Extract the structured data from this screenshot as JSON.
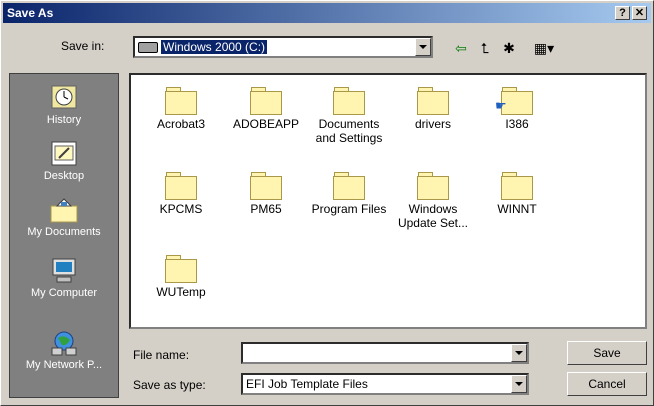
{
  "window": {
    "title": "Save As",
    "help_label": "?",
    "close_label": "✕"
  },
  "save_in": {
    "label": "Save in:",
    "value": "Windows 2000 (C:)"
  },
  "toolbar": {
    "back": "⇦",
    "up": "⮤",
    "new_folder": "✱",
    "views": "▦▾"
  },
  "places": [
    {
      "label": "History",
      "icon": "history-icon"
    },
    {
      "label": "Desktop",
      "icon": "desktop-icon"
    },
    {
      "label": "My Documents",
      "icon": "my-documents-icon"
    },
    {
      "label": "My Computer",
      "icon": "my-computer-icon"
    },
    {
      "label": "My Network P...",
      "icon": "my-network-places-icon"
    }
  ],
  "files": [
    {
      "name": "Acrobat3"
    },
    {
      "name": "ADOBEAPP"
    },
    {
      "name": "Documents and Settings"
    },
    {
      "name": "drivers"
    },
    {
      "name": "I386"
    },
    {
      "name": "KPCMS"
    },
    {
      "name": "PM65"
    },
    {
      "name": "Program Files"
    },
    {
      "name": "Windows Update Set..."
    },
    {
      "name": "WINNT"
    },
    {
      "name": "WUTemp"
    }
  ],
  "file_name": {
    "label": "File name:",
    "value": ""
  },
  "save_as_type": {
    "label": "Save as type:",
    "value": "EFI Job Template Files"
  },
  "buttons": {
    "save": "Save",
    "cancel": "Cancel"
  }
}
